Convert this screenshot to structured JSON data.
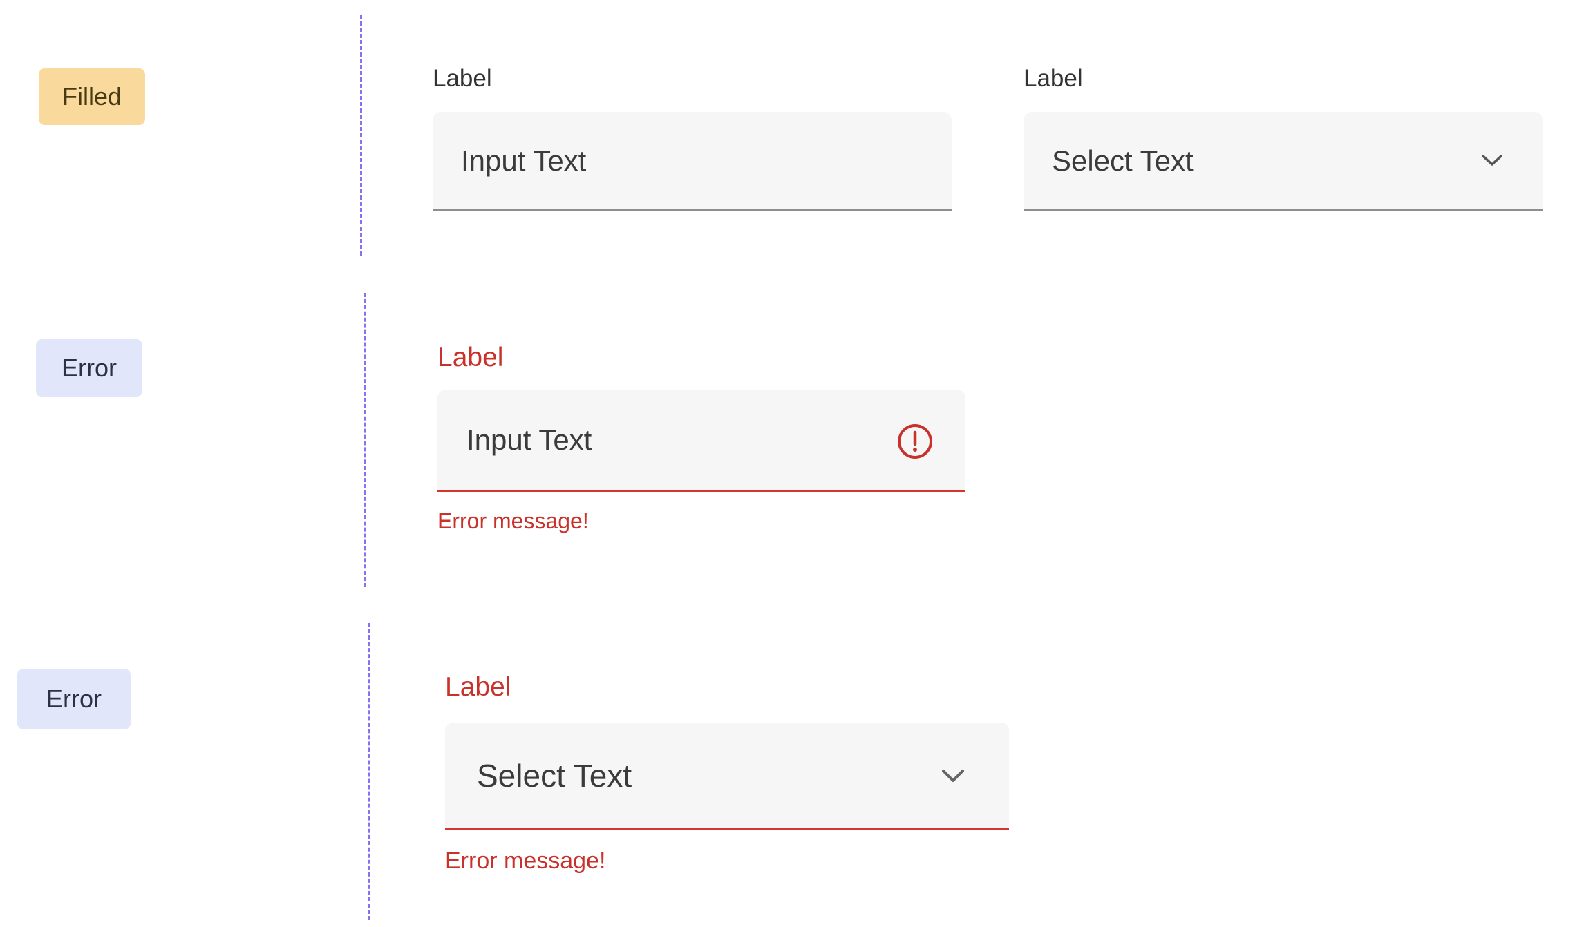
{
  "states": {
    "filled": "Filled",
    "error_1": "Error",
    "error_2": "Error"
  },
  "filled_row": {
    "input": {
      "label": "Label",
      "value": "Input Text"
    },
    "select": {
      "label": "Label",
      "value": "Select Text",
      "icon": "chevron-down-icon"
    }
  },
  "error_row_input": {
    "label": "Label",
    "value": "Input Text",
    "icon": "error-alert-icon",
    "message": "Error message!"
  },
  "error_row_select": {
    "label": "Label",
    "value": "Select Text",
    "icon": "chevron-down-icon",
    "message": "Error message!"
  },
  "colors": {
    "filled_badge": "#f9d99c",
    "error_badge": "#e1e6fb",
    "divider": "#8574f2",
    "field_bg": "#f6f6f6",
    "error": "#c8322b"
  }
}
